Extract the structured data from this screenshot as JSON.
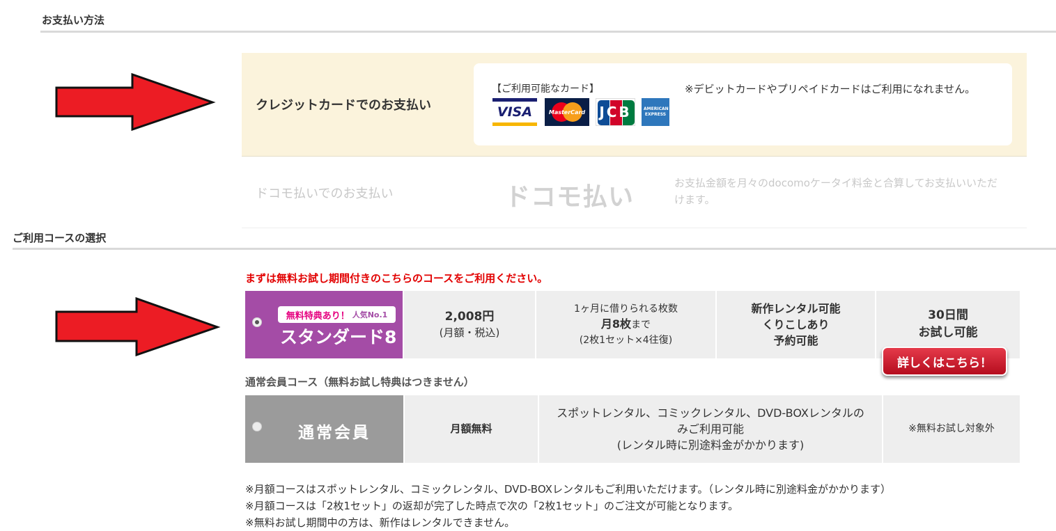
{
  "payment": {
    "heading": "お支払い方法",
    "credit": {
      "label": "クレジットカードでのお支払い",
      "cards_title": "【ご利用可能なカード】",
      "cards": [
        {
          "name": "visa-logo",
          "text": "VISA"
        },
        {
          "name": "mastercard-logo",
          "text": "MasterCard"
        },
        {
          "name": "jcb-logo",
          "text": "JCB"
        },
        {
          "name": "amex-logo",
          "text": "AMERICAN EXPRESS"
        }
      ],
      "note": "※デビットカードやプリペイドカードはご利用になれません。"
    },
    "docomo": {
      "label": "ドコモ払いでのお支払い",
      "logo_text": "ドコモ払い",
      "note": "お支払金額を月々のdocomoケータイ料金と合算してお支払いいただけます。"
    }
  },
  "course": {
    "heading": "ご利用コースの選択",
    "notice": "まずは無料お試し期間付きのこちらのコースをご利用ください。",
    "standard": {
      "badge": "無料特典あり！",
      "badge_rank": "人気No.1",
      "name": "スタンダード8",
      "price": "2,008円",
      "price_note": "(月額・税込)",
      "rental_title": "1ヶ月に借りられる枚数",
      "rental_amount": "月8枚",
      "rental_suffix": "まで",
      "rental_note": "(2枚1セット×4往復)",
      "features": [
        "新作レンタル可能",
        "くりこしあり",
        "予約可能"
      ],
      "trial_days": "30日間",
      "trial_label": "お試し可能",
      "detail_button": "詳しくはこちら！"
    },
    "regular_heading": "通常会員コース（無料お試し特典はつきません）",
    "regular": {
      "name": "通常会員",
      "price": "月額無料",
      "desc_line1": "スポットレンタル、コミックレンタル、DVD-BOXレンタルの",
      "desc_line2": "みご利用可能",
      "desc_line3": "(レンタル時に別途料金がかかります)",
      "trial": "※無料お試し対象外"
    },
    "footnotes": [
      "※月額コースはスポットレンタル、コミックレンタル、DVD-BOXレンタルもご利用いただけます。（レンタル時に別途料金がかかります）",
      "※月額コースは「2枚1セット」の返却が完了した時点で次の「2枚1セット」のご注文が可能となります。",
      "※無料お試し期間中の方は、新作はレンタルできません。"
    ]
  },
  "colors": {
    "arrow": "#ec1c24",
    "standard_purple": "#a44ca6",
    "regular_gray": "#9b9b9b",
    "notice_red": "#e20000",
    "credit_bg": "#fbf3dc"
  }
}
